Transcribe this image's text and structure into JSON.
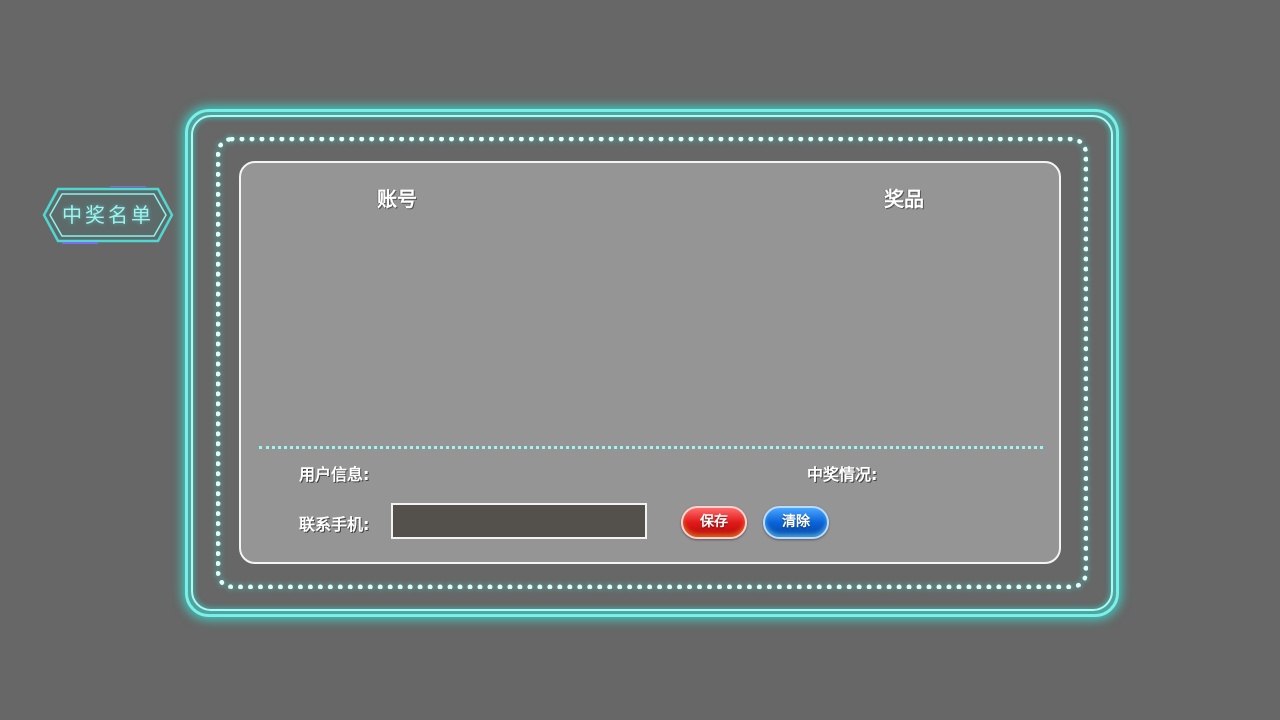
{
  "side_tag": {
    "label": "中奖名单"
  },
  "table": {
    "headers": {
      "account": "账号",
      "prize": "奖品"
    },
    "rows": []
  },
  "form": {
    "user_info_label": "用户信息:",
    "win_status_label": "中奖情况:",
    "phone_label": "联系手机:",
    "phone_value": "",
    "save_label": "保存",
    "clear_label": "清除"
  },
  "colors": {
    "background": "#666766",
    "neon": "#7ff2ec",
    "panel": "#959595",
    "save_button": "#e11a1a",
    "clear_button": "#0a63d8"
  },
  "icons": {
    "side_tag_frame": "hexagon-badge-icon"
  }
}
